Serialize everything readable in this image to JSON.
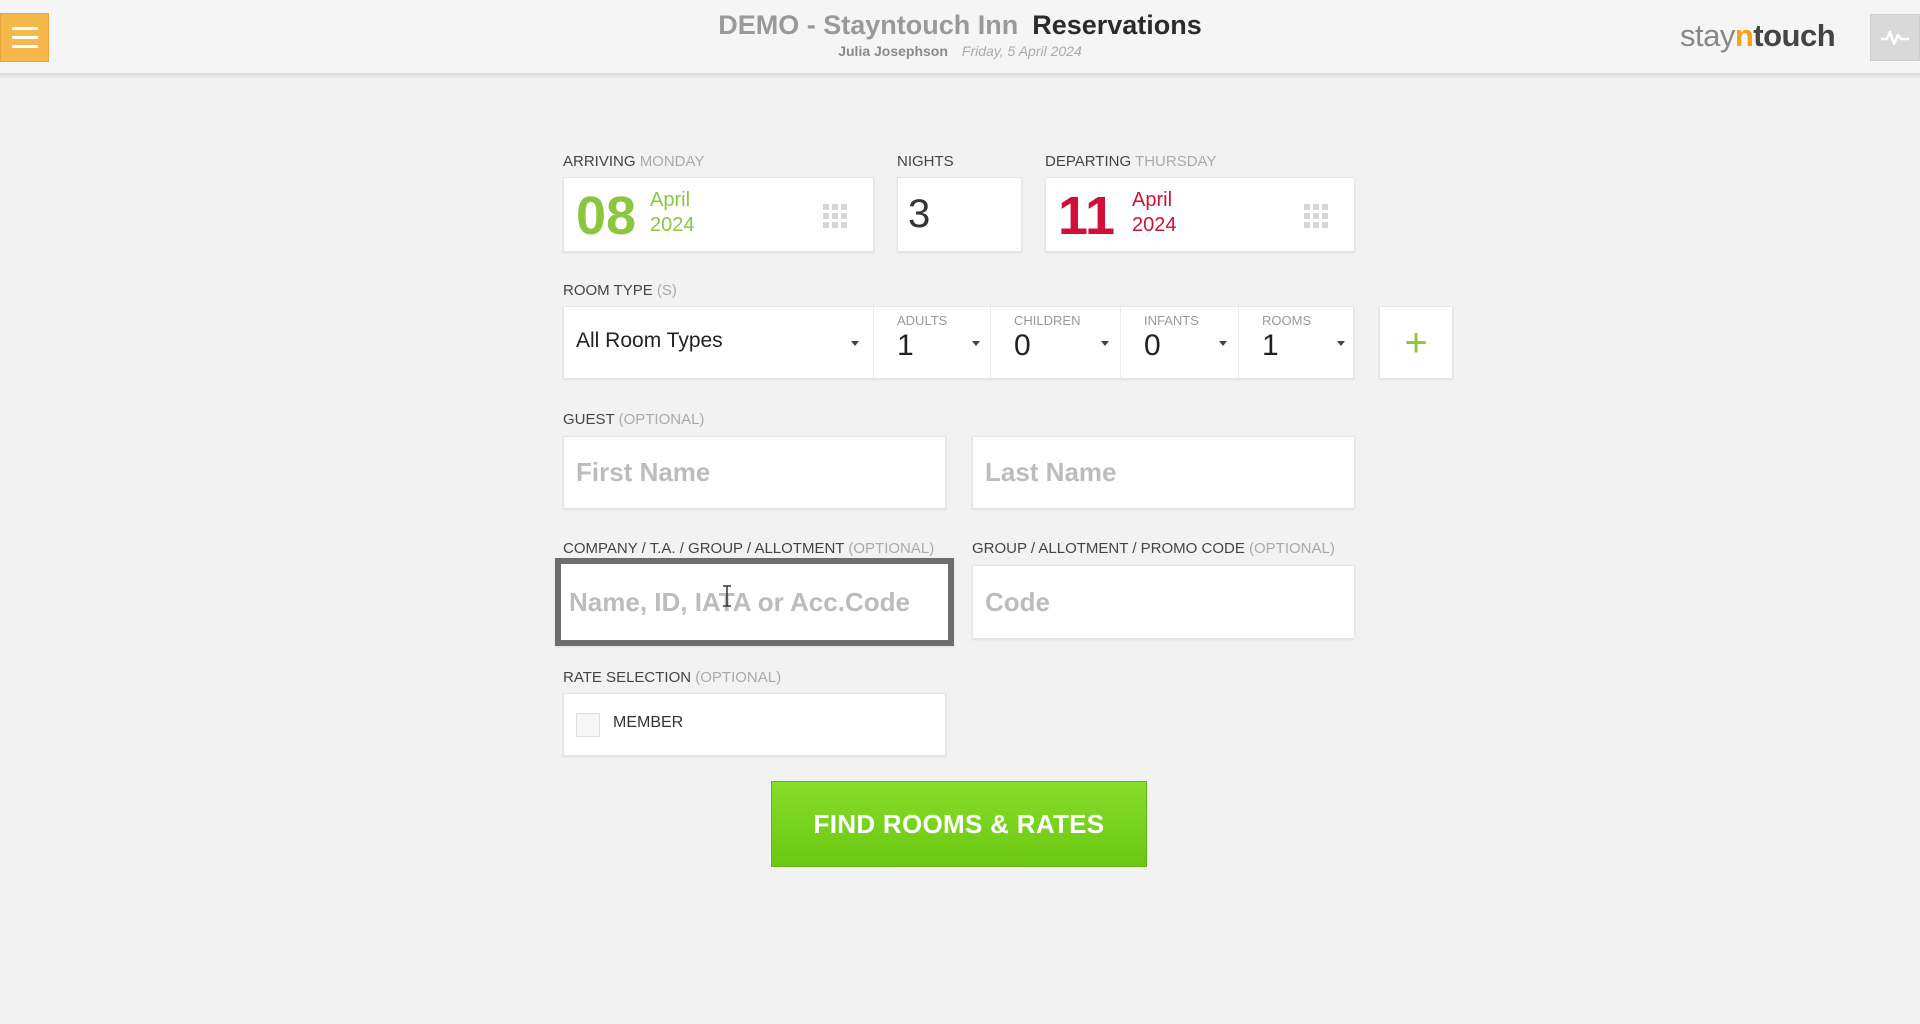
{
  "header": {
    "hotel_name": "DEMO - Stayntouch Inn",
    "page_title": "Reservations",
    "user_name": "Julia Josephson",
    "date": "Friday, 5 April 2024",
    "logo_pre": "stay",
    "logo_n": "n",
    "logo_post": "touch"
  },
  "arrival": {
    "label": "ARRIVING",
    "weekday": "MONDAY",
    "day": "08",
    "month": "April",
    "year": "2024",
    "icon": "calendar-grid-icon"
  },
  "nights": {
    "label": "NIGHTS",
    "value": "3"
  },
  "departure": {
    "label": "DEPARTING",
    "weekday": "THURSDAY",
    "day": "11",
    "month": "April",
    "year": "2024",
    "icon": "calendar-grid-icon"
  },
  "room_type": {
    "label": "ROOM TYPE",
    "label_suffix": "(S)",
    "selected": "All Room Types",
    "adults_label": "ADULTS",
    "adults": "1",
    "children_label": "CHILDREN",
    "children": "0",
    "infants_label": "INFANTS",
    "infants": "0",
    "rooms_label": "ROOMS",
    "rooms": "1",
    "add_icon": "+"
  },
  "guest": {
    "label": "GUEST",
    "label_suffix": "(OPTIONAL)",
    "first_placeholder": "First Name",
    "last_placeholder": "Last Name"
  },
  "company": {
    "label": "COMPANY / T.A. / GROUP / ALLOTMENT",
    "label_suffix": "(OPTIONAL)",
    "placeholder": "Name, ID, IATA or Acc.Code"
  },
  "promo": {
    "label": "GROUP / ALLOTMENT / PROMO CODE",
    "label_suffix": "(OPTIONAL)",
    "placeholder": "Code"
  },
  "rate": {
    "label": "RATE SELECTION",
    "label_suffix": "(OPTIONAL)",
    "member_label": "MEMBER"
  },
  "find_button": "FIND ROOMS & RATES",
  "colors": {
    "accent_green": "#8cc63f",
    "departure_red": "#d0103a",
    "menu_orange": "#f7b84b",
    "button_green": "#7ed321"
  }
}
